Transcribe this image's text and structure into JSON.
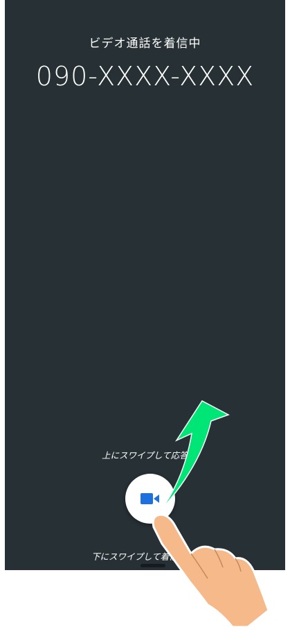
{
  "call": {
    "status_label": "ビデオ通話を着信中",
    "number": "090-XXXX-XXXX"
  },
  "hints": {
    "swipe_up": "上にスワイプして応答",
    "swipe_down": "下にスワイプして着信拒否"
  },
  "answer_button": {
    "icon": "video-camera-icon"
  },
  "illustration": {
    "arrow_color": "#00e676",
    "hand_color": "#f5b98a"
  },
  "colors": {
    "background": "#263035",
    "accent": "#1e6fe0"
  }
}
